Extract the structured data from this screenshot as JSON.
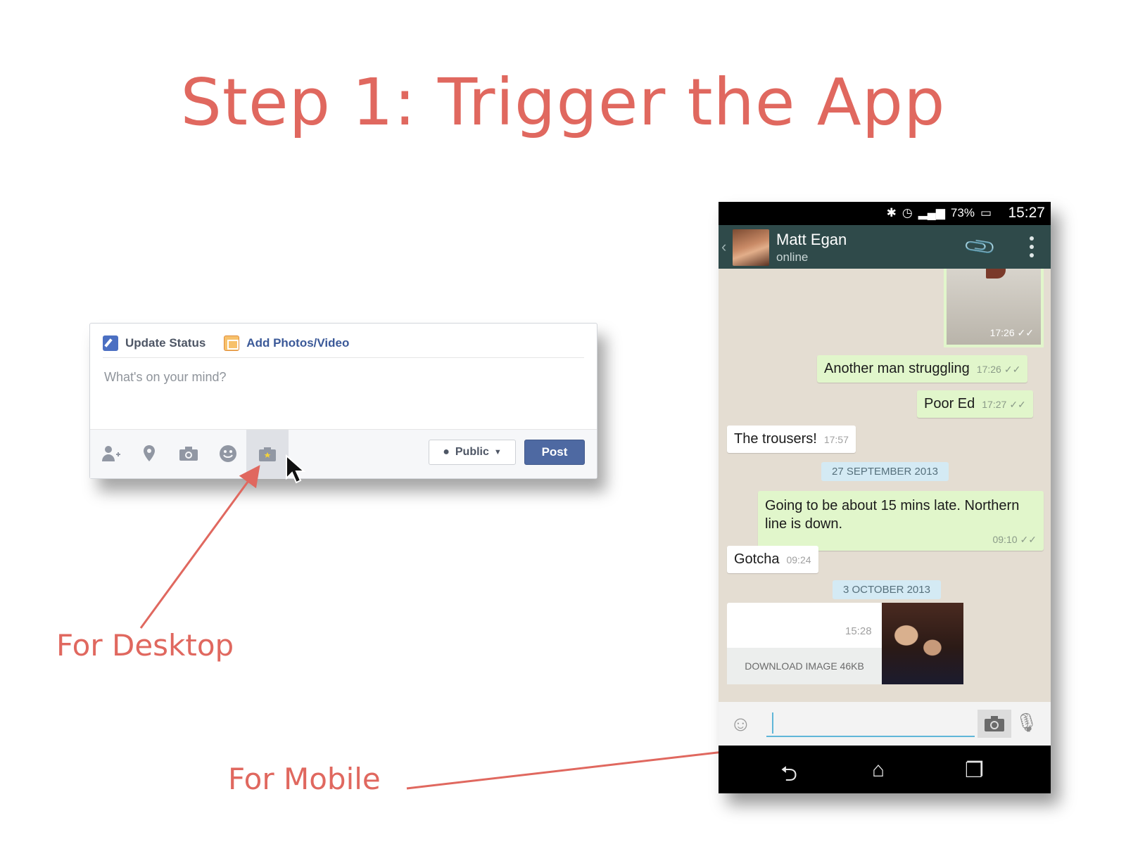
{
  "slide": {
    "title": "Step 1: Trigger the App",
    "label_desktop": "For Desktop",
    "label_mobile": "For Mobile",
    "accent_color": "#e0685f"
  },
  "facebook": {
    "tab_update": "Update Status",
    "tab_photos": "Add Photos/Video",
    "placeholder": "What's on your mind?",
    "privacy": "Public",
    "post": "Post",
    "tools": [
      "tag-friends-icon",
      "location-icon",
      "camera-icon",
      "feeling-icon",
      "app-icon"
    ],
    "brand_color": "#4e69a2"
  },
  "phone": {
    "status": {
      "battery": "73%",
      "time": "15:27"
    },
    "header": {
      "name": "Matt Egan",
      "status": "online"
    },
    "messages": [
      {
        "type": "image",
        "dir": "out",
        "time": "17:26"
      },
      {
        "type": "text",
        "dir": "out",
        "text": "Another man struggling",
        "time": "17:26"
      },
      {
        "type": "text",
        "dir": "out",
        "text": "Poor Ed",
        "time": "17:27"
      },
      {
        "type": "text",
        "dir": "in",
        "text": "The trousers!",
        "time": "17:57"
      },
      {
        "type": "date",
        "text": "27 SEPTEMBER 2013"
      },
      {
        "type": "text",
        "dir": "out",
        "text": "Going to be about 15 mins late. Northern line is down.",
        "time": "09:10"
      },
      {
        "type": "text",
        "dir": "in",
        "text": "Gotcha",
        "time": "09:24"
      },
      {
        "type": "date",
        "text": "3 OCTOBER 2013"
      },
      {
        "type": "image",
        "dir": "in",
        "time": "15:28",
        "download": "DOWNLOAD IMAGE 46KB"
      }
    ]
  }
}
